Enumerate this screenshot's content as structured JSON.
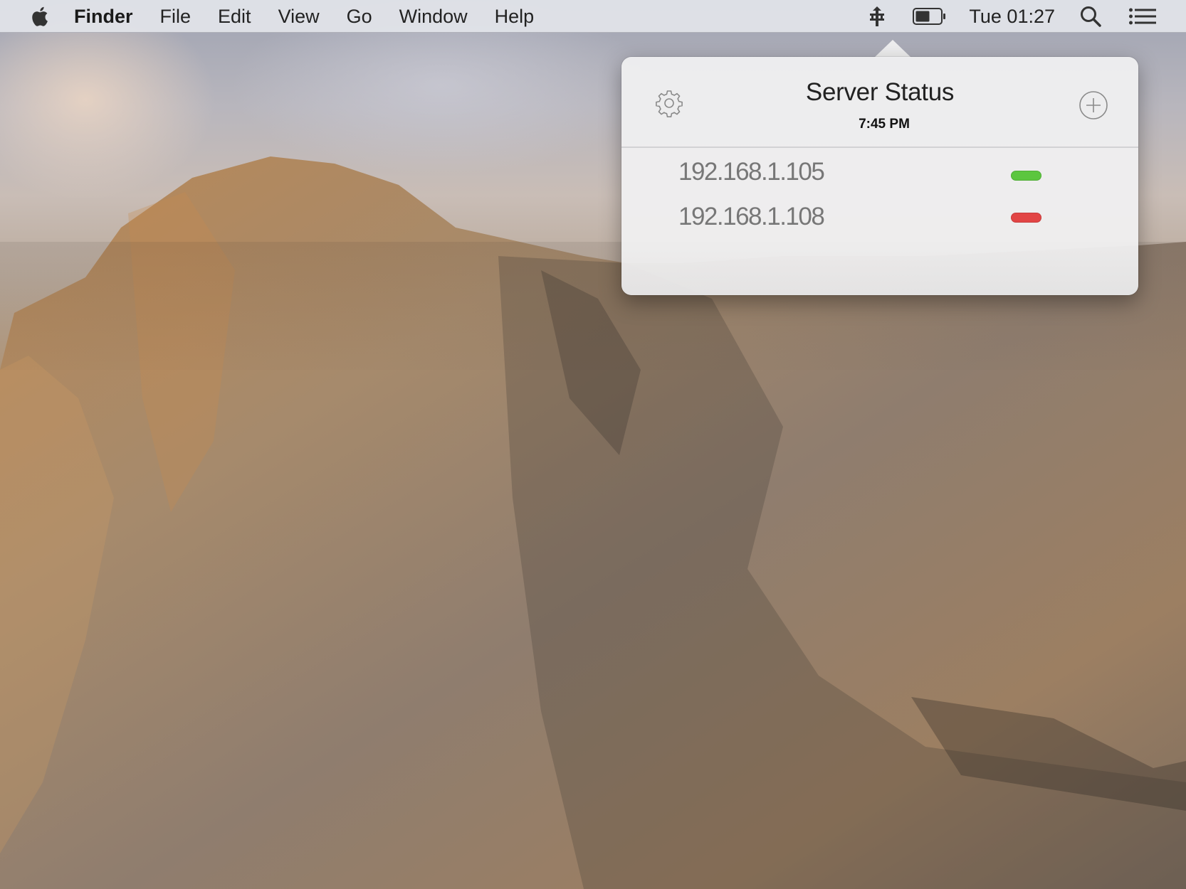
{
  "menubar": {
    "apple_icon": "apple-logo-icon",
    "app_name": "Finder",
    "items": [
      "File",
      "Edit",
      "View",
      "Go",
      "Window",
      "Help"
    ],
    "status_icons": [
      "network-status-icon",
      "battery-icon"
    ],
    "clock": "Tue 01:27",
    "search_icon": "spotlight-search-icon",
    "list_icon": "notification-center-icon"
  },
  "popover": {
    "title": "Server Status",
    "time": "7:45 PM",
    "settings_icon": "gear-icon",
    "add_icon": "plus-circle-icon",
    "servers": [
      {
        "ip": "192.168.1.105",
        "status": "up",
        "color": "#5cc63f"
      },
      {
        "ip": "192.168.1.108",
        "status": "down",
        "color": "#e24545"
      }
    ]
  },
  "wallpaper": "mountain cliff desktop background"
}
